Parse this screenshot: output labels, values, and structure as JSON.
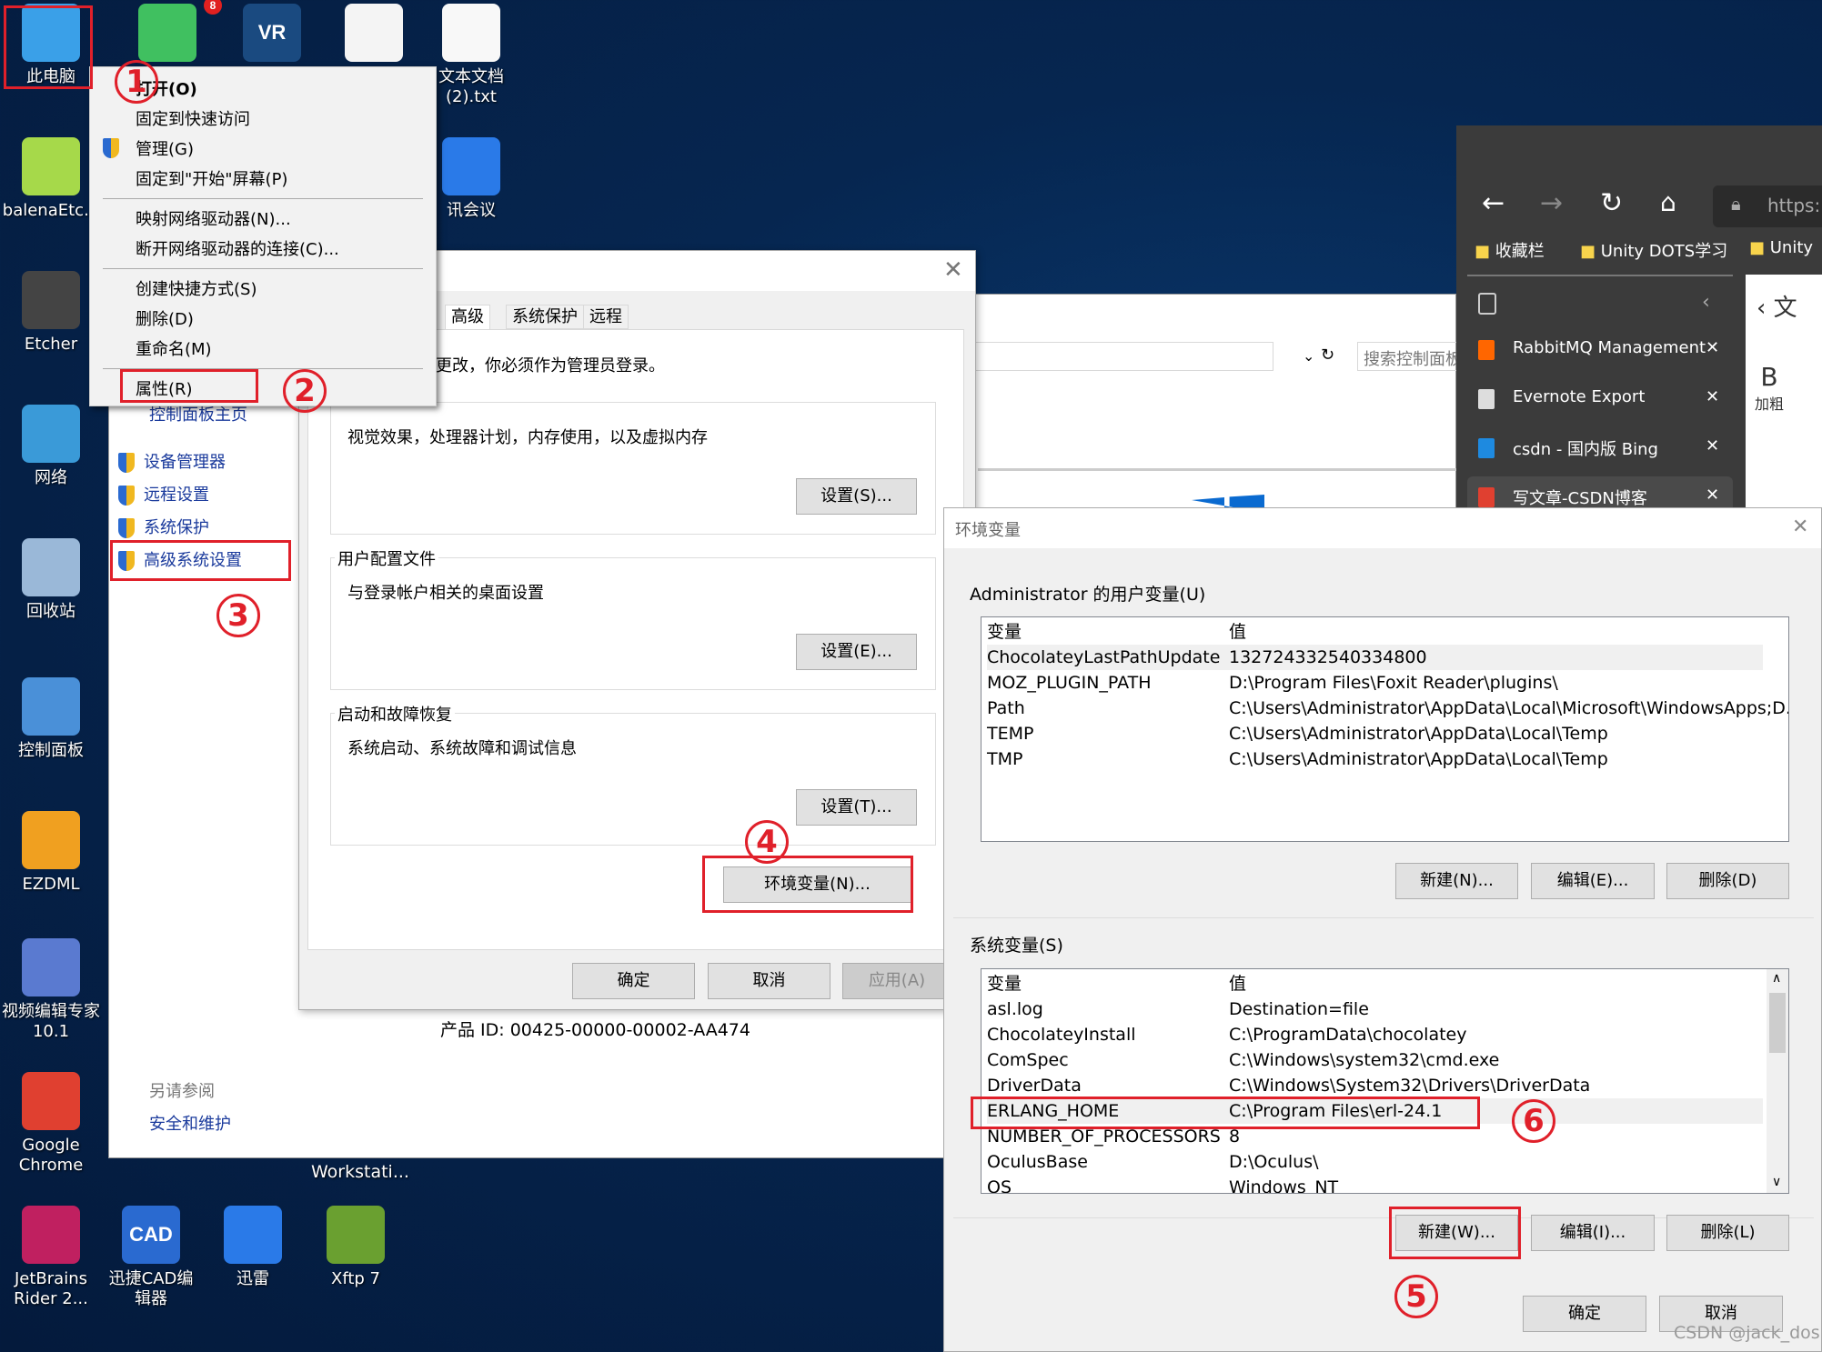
{
  "desktop": {
    "icons_left": [
      {
        "label": "此电脑",
        "color": "#3aa0e8"
      },
      {
        "label": "balenaEtc...",
        "color": "#a6d94a"
      },
      {
        "label": "Etcher",
        "color": "#444"
      },
      {
        "label": "网络",
        "color": "#3a9ad8"
      },
      {
        "label": "回收站",
        "color": "#9ab8d8"
      },
      {
        "label": "控制面板",
        "color": "#4a90d8"
      },
      {
        "label": "EZDML",
        "color": "#f0a020"
      },
      {
        "label": "视频编辑专家\n10.1",
        "color": "#5a7ad0"
      },
      {
        "label": "Google\nChrome",
        "color": "#e04030"
      },
      {
        "label": "JetBrains\nRider 2...",
        "color": "#c02060"
      }
    ],
    "icons_top": [
      {
        "label": "",
        "color": "#40c060",
        "badge": "8"
      },
      {
        "label": "",
        "color": "#1a4a80",
        "text": "VR"
      },
      {
        "label": "",
        "color": "#f4f4f4"
      },
      {
        "label": "文本文档\n(2).txt",
        "color": "#f8f8f8"
      },
      {
        "label": "讯会议",
        "color": "#2a7ae8"
      }
    ],
    "icons_bottom": [
      {
        "label": "迅捷CAD编\n辑器",
        "color": "#2a6ad0",
        "text": "CAD"
      },
      {
        "label": "迅雷",
        "color": "#2a7ae8"
      },
      {
        "label": "Xftp 7",
        "color": "#6aa030"
      }
    ],
    "workstation_label": "Workstati..."
  },
  "context_menu": {
    "items": [
      "打开(O)",
      "固定到快速访问",
      "管理(G)",
      "固定到\"开始\"屏幕(P)",
      "映射网络驱动器(N)...",
      "断开网络驱动器的连接(C)...",
      "创建快捷方式(S)",
      "删除(D)",
      "重命名(M)",
      "属性(R)"
    ]
  },
  "control_panel": {
    "home": "控制面板主页",
    "links": [
      "设备管理器",
      "远程设置",
      "系统保护",
      "高级系统设置"
    ],
    "see_also": "另请参阅",
    "security": "安全和维护",
    "product_id": "产品 ID: 00425-00000-00002-AA474",
    "search_placeholder": "搜索控制面板"
  },
  "system_properties": {
    "tabs": [
      "高级",
      "系统保护",
      "远程"
    ],
    "admin_note": "更改，你必须作为管理员登录。",
    "performance": {
      "desc": "视觉效果，处理器计划，内存使用，以及虚拟内存",
      "button": "设置(S)..."
    },
    "profiles": {
      "title": "用户配置文件",
      "desc": "与登录帐户相关的桌面设置",
      "button": "设置(E)..."
    },
    "startup": {
      "title": "启动和故障恢复",
      "desc": "系统启动、系统故障和调试信息",
      "button": "设置(T)..."
    },
    "env_button": "环境变量(N)...",
    "ok": "确定",
    "cancel": "取消",
    "apply": "应用(A)"
  },
  "browser": {
    "url": "https:",
    "bookmarks": [
      "收藏栏",
      "Unity DOTS学习",
      "Unity"
    ],
    "tabs": [
      {
        "title": "RabbitMQ Management",
        "color": "#ff6600"
      },
      {
        "title": "Evernote Export",
        "color": "#ddd"
      },
      {
        "title": "csdn - 国内版 Bing",
        "color": "#1e8ae0"
      },
      {
        "title": "写文章-CSDN博客",
        "color": "#e04030"
      }
    ],
    "editor_bold": "B",
    "editor_bold_label": "加粗",
    "editor_char": "文"
  },
  "env_dialog": {
    "title": "环境变量",
    "user_label": "Administrator 的用户变量(U)",
    "col_var": "变量",
    "col_val": "值",
    "user_vars": [
      [
        "ChocolateyLastPathUpdate",
        "132724332540334800"
      ],
      [
        "MOZ_PLUGIN_PATH",
        "D:\\Program Files\\Foxit Reader\\plugins\\"
      ],
      [
        "Path",
        "C:\\Users\\Administrator\\AppData\\Local\\Microsoft\\WindowsApps;D..."
      ],
      [
        "TEMP",
        "C:\\Users\\Administrator\\AppData\\Local\\Temp"
      ],
      [
        "TMP",
        "C:\\Users\\Administrator\\AppData\\Local\\Temp"
      ]
    ],
    "user_buttons": [
      "新建(N)...",
      "编辑(E)...",
      "删除(D)"
    ],
    "sys_label": "系统变量(S)",
    "sys_vars": [
      [
        "asl.log",
        "Destination=file"
      ],
      [
        "ChocolateyInstall",
        "C:\\ProgramData\\chocolatey"
      ],
      [
        "ComSpec",
        "C:\\Windows\\system32\\cmd.exe"
      ],
      [
        "DriverData",
        "C:\\Windows\\System32\\Drivers\\DriverData"
      ],
      [
        "ERLANG_HOME",
        "C:\\Program Files\\erl-24.1"
      ],
      [
        "NUMBER_OF_PROCESSORS",
        "8"
      ],
      [
        "OculusBase",
        "D:\\Oculus\\"
      ],
      [
        "OS",
        "Windows_NT"
      ]
    ],
    "sys_buttons": [
      "新建(W)...",
      "编辑(I)...",
      "删除(L)"
    ],
    "ok": "确定",
    "cancel": "取消"
  },
  "annotations": [
    "1",
    "2",
    "3",
    "4",
    "5",
    "6"
  ],
  "watermark": "CSDN @jack_dos"
}
